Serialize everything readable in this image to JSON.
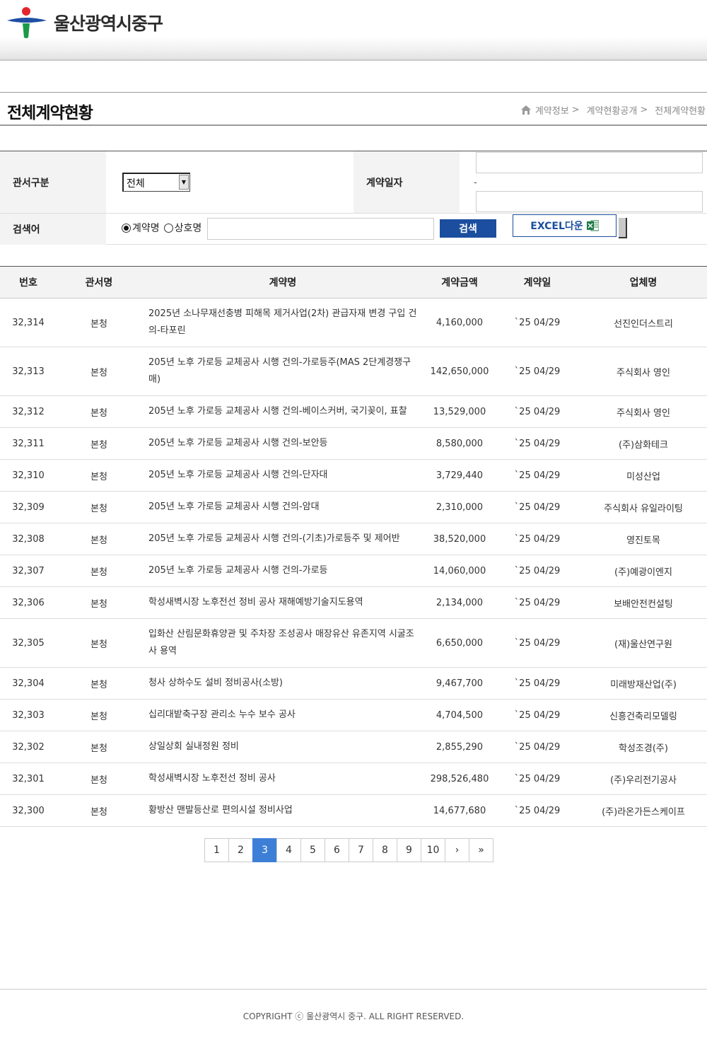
{
  "site": {
    "name": "울산광역시중구"
  },
  "page": {
    "title": "전체계약현황",
    "breadcrumb": [
      "계약정보",
      "계약현황공개",
      "전체계약현황"
    ],
    "breadcrumb_sep": ">"
  },
  "search": {
    "dept_label": "관서구분",
    "dept_value": "전체",
    "date_label": "계약일자",
    "date_dash": "-",
    "keyword_label": "검색어",
    "radio_options": [
      "계약명",
      "상호명"
    ],
    "radio_selected": "계약명",
    "search_button": "검색",
    "excel_button": "EXCEL다운"
  },
  "table": {
    "headers": [
      "번호",
      "관서명",
      "계약명",
      "계약금액",
      "계약일",
      "업체명"
    ],
    "rows": [
      {
        "no": "32,314",
        "dept": "본청",
        "name": "2025년 소나무재선충병 피해목 제거사업(2차) 관급자재 변경 구입 건의-타포린",
        "amount": "4,160,000",
        "date": "`25 04/29",
        "company": "선진인더스트리"
      },
      {
        "no": "32,313",
        "dept": "본청",
        "name": "205년 노후 가로등 교체공사 시행 건의-가로등주(MAS 2단계경쟁구매)",
        "amount": "142,650,000",
        "date": "`25 04/29",
        "company": "주식회사 영인"
      },
      {
        "no": "32,312",
        "dept": "본청",
        "name": "205년 노후 가로등 교체공사 시행 건의-베이스커버, 국기꽂이, 표찰",
        "amount": "13,529,000",
        "date": "`25 04/29",
        "company": "주식회사 영인"
      },
      {
        "no": "32,311",
        "dept": "본청",
        "name": "205년 노후 가로등 교체공사 시행 건의-보안등",
        "amount": "8,580,000",
        "date": "`25 04/29",
        "company": "(주)삼화테크"
      },
      {
        "no": "32,310",
        "dept": "본청",
        "name": "205년 노후 가로등 교체공사 시행 건의-단자대",
        "amount": "3,729,440",
        "date": "`25 04/29",
        "company": "미성산업"
      },
      {
        "no": "32,309",
        "dept": "본청",
        "name": "205년 노후 가로등 교체공사 시행 건의-암대",
        "amount": "2,310,000",
        "date": "`25 04/29",
        "company": "주식회사 유일라이팅"
      },
      {
        "no": "32,308",
        "dept": "본청",
        "name": "205년 노후 가로등 교체공사 시행 건의-(기초)가로등주 및 제어반",
        "amount": "38,520,000",
        "date": "`25 04/29",
        "company": "영진토목"
      },
      {
        "no": "32,307",
        "dept": "본청",
        "name": "205년 노후 가로등 교체공사 시행 건의-가로등",
        "amount": "14,060,000",
        "date": "`25 04/29",
        "company": "(주)예광이엔지"
      },
      {
        "no": "32,306",
        "dept": "본청",
        "name": "학성새벽시장 노후전선 정비 공사 재해예방기술지도용역",
        "amount": "2,134,000",
        "date": "`25 04/29",
        "company": "보배안전컨설팅"
      },
      {
        "no": "32,305",
        "dept": "본청",
        "name": "입화산 산림문화휴양관 및 주차장 조성공사 매장유산 유존지역 시굴조사 용역",
        "amount": "6,650,000",
        "date": "`25 04/29",
        "company": "(재)울산연구원"
      },
      {
        "no": "32,304",
        "dept": "본청",
        "name": "청사 상하수도 설비 정비공사(소방)",
        "amount": "9,467,700",
        "date": "`25 04/29",
        "company": "미래방재산업(주)"
      },
      {
        "no": "32,303",
        "dept": "본청",
        "name": "십리대밭축구장 관리소 누수 보수 공사",
        "amount": "4,704,500",
        "date": "`25 04/29",
        "company": "신흥건축리모델링"
      },
      {
        "no": "32,302",
        "dept": "본청",
        "name": "상일상회 실내정원 정비",
        "amount": "2,855,290",
        "date": "`25 04/29",
        "company": "학성조경(주)"
      },
      {
        "no": "32,301",
        "dept": "본청",
        "name": "학성새벽시장 노후전선 정비 공사",
        "amount": "298,526,480",
        "date": "`25 04/29",
        "company": "(주)우리전기공사"
      },
      {
        "no": "32,300",
        "dept": "본청",
        "name": "황방산 맨발등산로 편의시설 정비사업",
        "amount": "14,677,680",
        "date": "`25 04/29",
        "company": "(주)라온가든스케이프"
      }
    ]
  },
  "pagination": {
    "pages": [
      "1",
      "2",
      "3",
      "4",
      "5",
      "6",
      "7",
      "8",
      "9",
      "10"
    ],
    "current": "3",
    "next": "›",
    "last": "»"
  },
  "footer": {
    "copyright": "COPYRIGHT ⓒ 울산광역시 중구. ALL RIGHT RESERVED."
  },
  "colors": {
    "primary": "#1b4e9e",
    "active_page": "#3d7fd6",
    "logo_red": "#e3262d",
    "logo_blue": "#1f4fa3",
    "logo_green": "#1a9a48"
  }
}
